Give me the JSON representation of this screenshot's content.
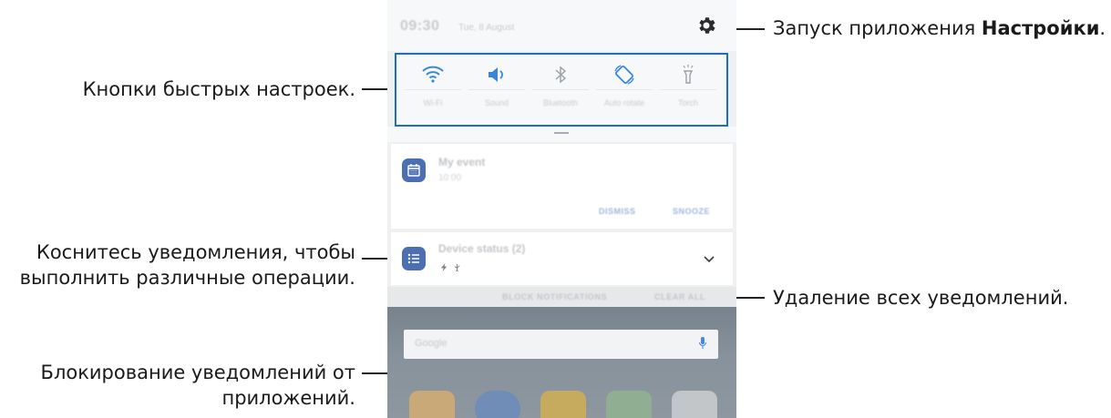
{
  "callouts": {
    "settings_prefix": "Запуск приложения ",
    "settings_bold": "Настройки",
    "settings_suffix": ".",
    "quick_settings": "Кнопки быстрых настроек.",
    "tap_notification_line1": "Коснитесь уведомления, чтобы",
    "tap_notification_line2": "выполнить различные операции.",
    "clear_all": "Удаление всех уведомлений.",
    "block_line1": "Блокирование уведомлений от",
    "block_line2": "приложений."
  },
  "status_bar": {
    "time": "09:30",
    "date": "Tue, 8 August",
    "settings_icon": "gear-icon"
  },
  "quick_settings": [
    {
      "icon": "wifi-icon",
      "label": "Wi-Fi"
    },
    {
      "icon": "sound-icon",
      "label": "Sound"
    },
    {
      "icon": "bluetooth-icon",
      "label": "Bluetooth"
    },
    {
      "icon": "auto-rotate-icon",
      "label": "Auto rotate"
    },
    {
      "icon": "torch-icon",
      "label": "Torch"
    }
  ],
  "notifications": [
    {
      "icon": "calendar-icon",
      "title": "My event",
      "subtitle": "10:00",
      "actions": [
        "DISMISS",
        "SNOOZE"
      ]
    },
    {
      "icon": "list-icon",
      "title": "Device status (2)",
      "subtitle": "",
      "expand_icon": "chevron-down-icon"
    }
  ],
  "footer": {
    "block": "BLOCK NOTIFICATIONS",
    "clear": "CLEAR ALL"
  },
  "home": {
    "search_placeholder": "Google",
    "mic_icon": "mic-icon"
  },
  "colors": {
    "highlight_border": "#1b6ec2",
    "app_icon": "#4b6fb1",
    "accent_icon": "#2f7bd2"
  }
}
